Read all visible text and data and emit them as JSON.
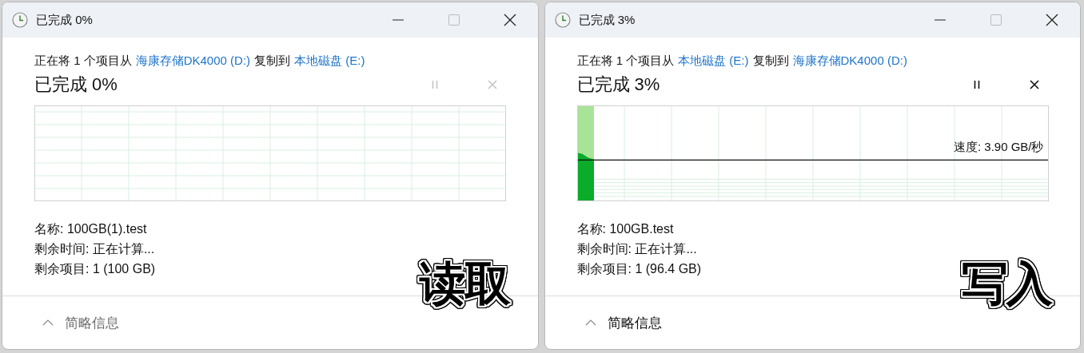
{
  "windows": [
    {
      "title": "已完成 0%",
      "description": [
        {
          "kind": "text",
          "text": "正在将 1 个项目从"
        },
        {
          "kind": "link",
          "text": "海康存储DK4000 (D:)"
        },
        {
          "kind": "text",
          "text": "复制到"
        },
        {
          "kind": "link",
          "text": "本地磁盘 (E:)"
        }
      ],
      "heading": "已完成 0%",
      "controls_disabled": true,
      "graph": {
        "kind": "idle"
      },
      "details": [
        "名称: 100GB(1).test",
        "剩余时间: 正在计算...",
        "剩余项目: 1 (100 GB)"
      ],
      "caption": "读取",
      "footer": {
        "label": "简略信息",
        "disabled": true
      }
    },
    {
      "title": "已完成 3%",
      "description": [
        {
          "kind": "text",
          "text": "正在将 1 个项目从"
        },
        {
          "kind": "link",
          "text": "本地磁盘 (E:)"
        },
        {
          "kind": "text",
          "text": "复制到"
        },
        {
          "kind": "link",
          "text": "海康存储DK4000 (D:)"
        }
      ],
      "heading": "已完成 3%",
      "controls_disabled": false,
      "graph": {
        "kind": "active",
        "speed": "速度: 3.90 GB/秒"
      },
      "details": [
        "名称: 100GB.test",
        "剩余时间: 正在计算...",
        "剩余项目: 1 (96.4 GB)"
      ],
      "caption": "写入",
      "footer": {
        "label": "简略信息",
        "disabled": false
      }
    }
  ]
}
